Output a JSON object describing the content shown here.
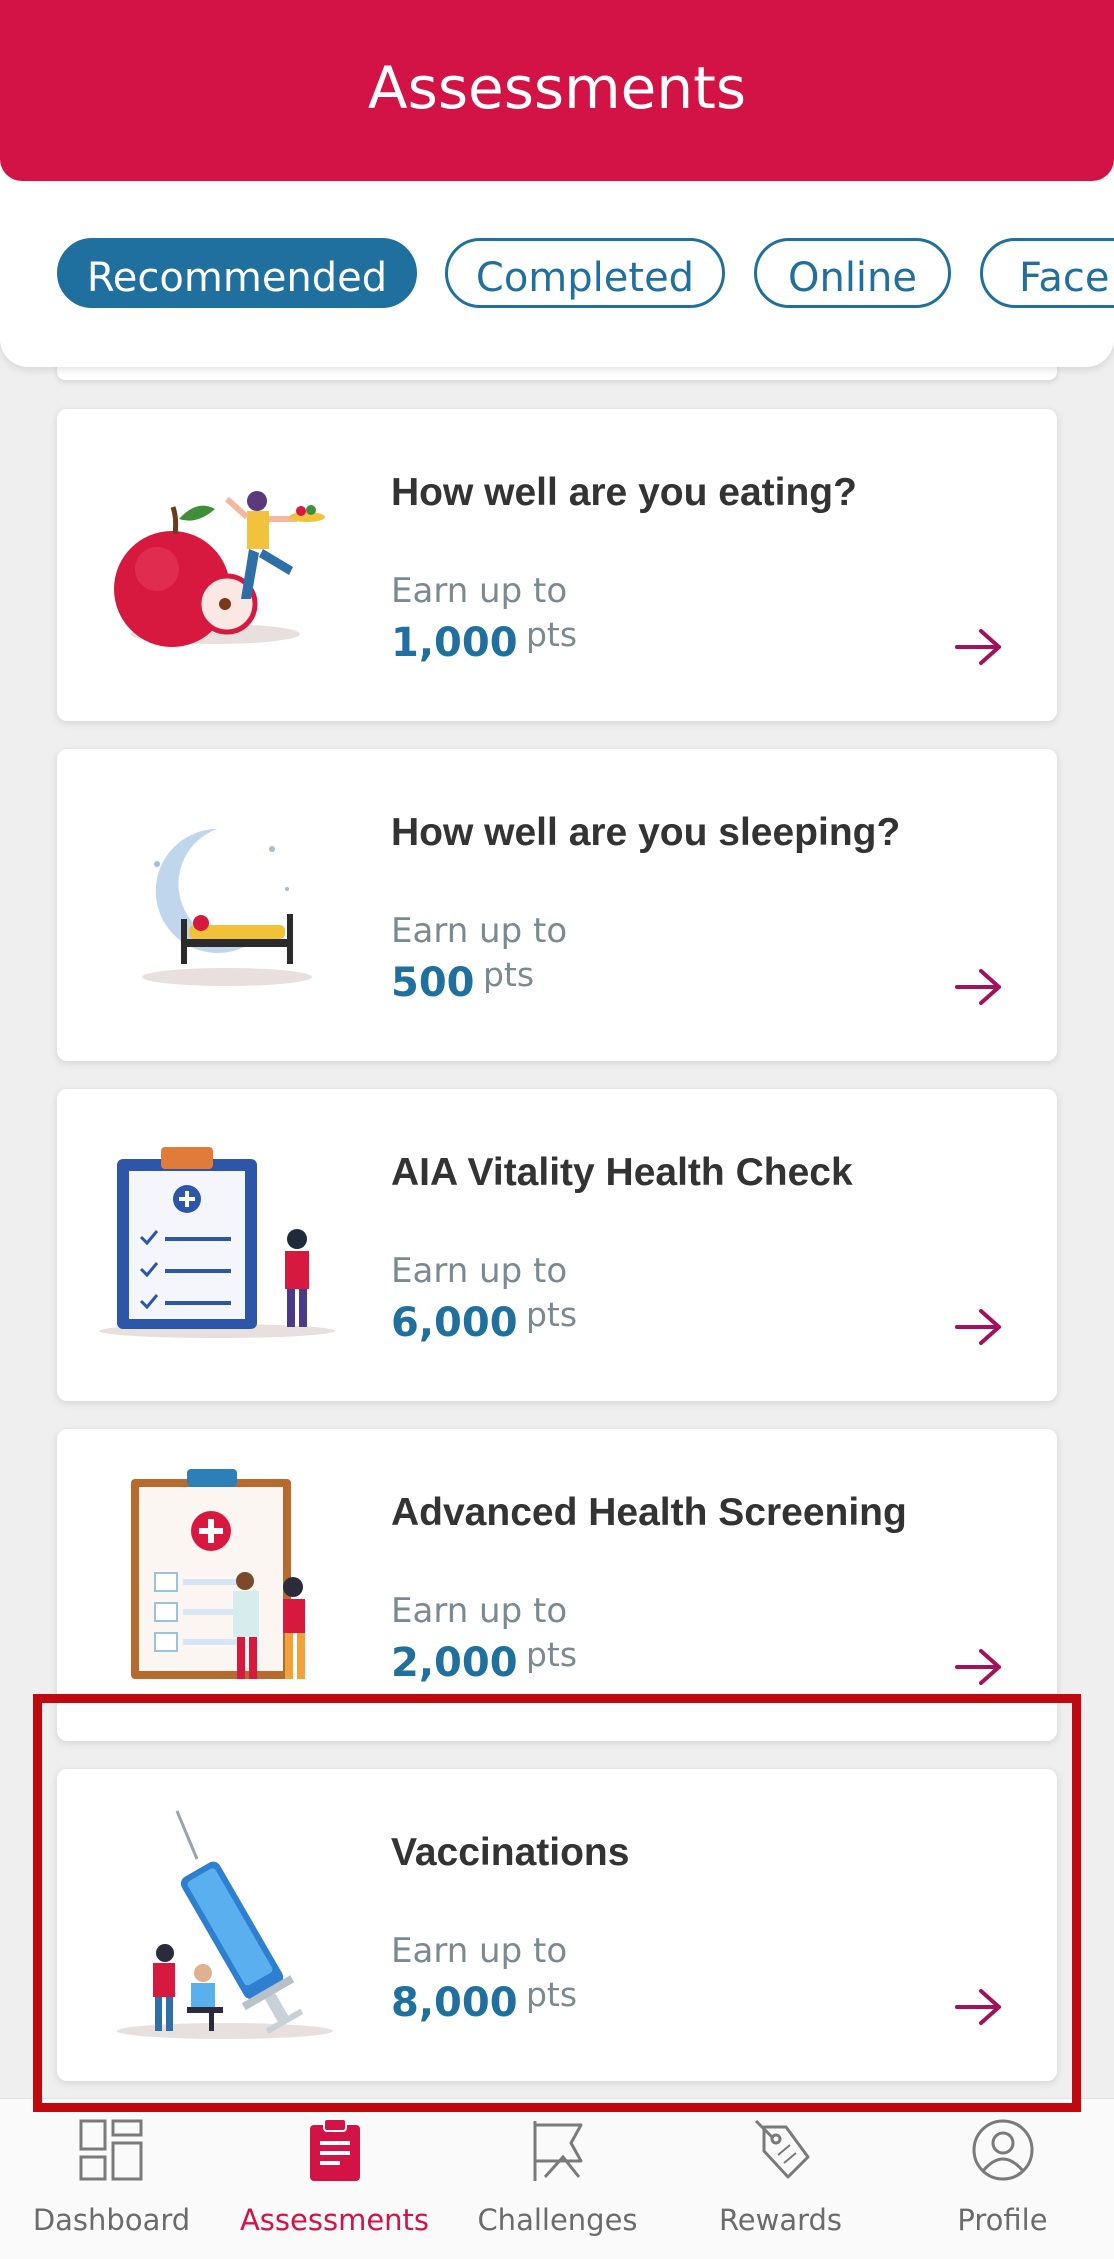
{
  "header": {
    "title": "Assessments"
  },
  "filters": [
    {
      "label": "Recommended",
      "active": true
    },
    {
      "label": "Completed",
      "active": false
    },
    {
      "label": "Online",
      "active": false
    },
    {
      "label": "Face",
      "active": false
    }
  ],
  "cards": [
    {
      "title": "How well are you eating?",
      "earn_label": "Earn up to",
      "points": "1,000",
      "unit": "pts",
      "illustration": "apple-person-illustration"
    },
    {
      "title": "How well are you sleeping?",
      "earn_label": "Earn up to",
      "points": "500",
      "unit": "pts",
      "illustration": "moon-bed-illustration"
    },
    {
      "title": "AIA Vitality Health Check",
      "earn_label": "Earn up to",
      "points": "6,000",
      "unit": "pts",
      "illustration": "clipboard-person-illustration"
    },
    {
      "title": "Advanced Health Screening",
      "earn_label": "Earn up to",
      "points": "2,000",
      "unit": "pts",
      "illustration": "clipboard-doctor-illustration"
    },
    {
      "title": "Vaccinations",
      "earn_label": "Earn up to",
      "points": "8,000",
      "unit": "pts",
      "illustration": "syringe-illustration"
    }
  ],
  "bottom_nav": [
    {
      "label": "Dashboard",
      "icon": "dashboard-icon",
      "active": false
    },
    {
      "label": "Assessments",
      "icon": "clipboard-icon",
      "active": true
    },
    {
      "label": "Challenges",
      "icon": "flag-icon",
      "active": false
    },
    {
      "label": "Rewards",
      "icon": "tag-icon",
      "active": false
    },
    {
      "label": "Profile",
      "icon": "profile-icon",
      "active": false
    }
  ],
  "colors": {
    "brand_red": "#d31245",
    "accent_blue": "#1f6f9f",
    "arrow": "#a5105a",
    "highlight": "#c0080f"
  }
}
